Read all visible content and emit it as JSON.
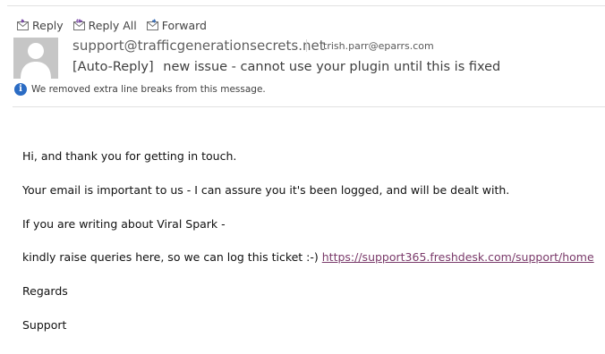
{
  "actions": {
    "reply": "Reply",
    "reply_all": "Reply All",
    "forward": "Forward"
  },
  "header": {
    "sender": "support@trafficgenerationsecrets.net",
    "recipient": "trish.parr@eparrs.com",
    "subject_prefix": "[Auto-Reply]",
    "subject": "new issue - cannot use your plugin until this is fixed",
    "info_message": "We removed extra line breaks from this message.",
    "info_icon": "info-icon"
  },
  "message": {
    "greeting": "Hi, and thank you for getting in touch.",
    "line_important": "Your email is important to us - I can assure you it's been logged, and will be dealt with.",
    "line_viral": "If you are writing about Viral Spark -",
    "line_queries": "kindly raise queries here, so we can log this ticket  :-) ",
    "link": "https://support365.freshdesk.com/support/home",
    "regards": "Regards",
    "signature": "Support"
  },
  "colors": {
    "link": "#7a3a6a",
    "info_icon": "#2b6cc4",
    "action_accent": "#7b4aa8"
  }
}
